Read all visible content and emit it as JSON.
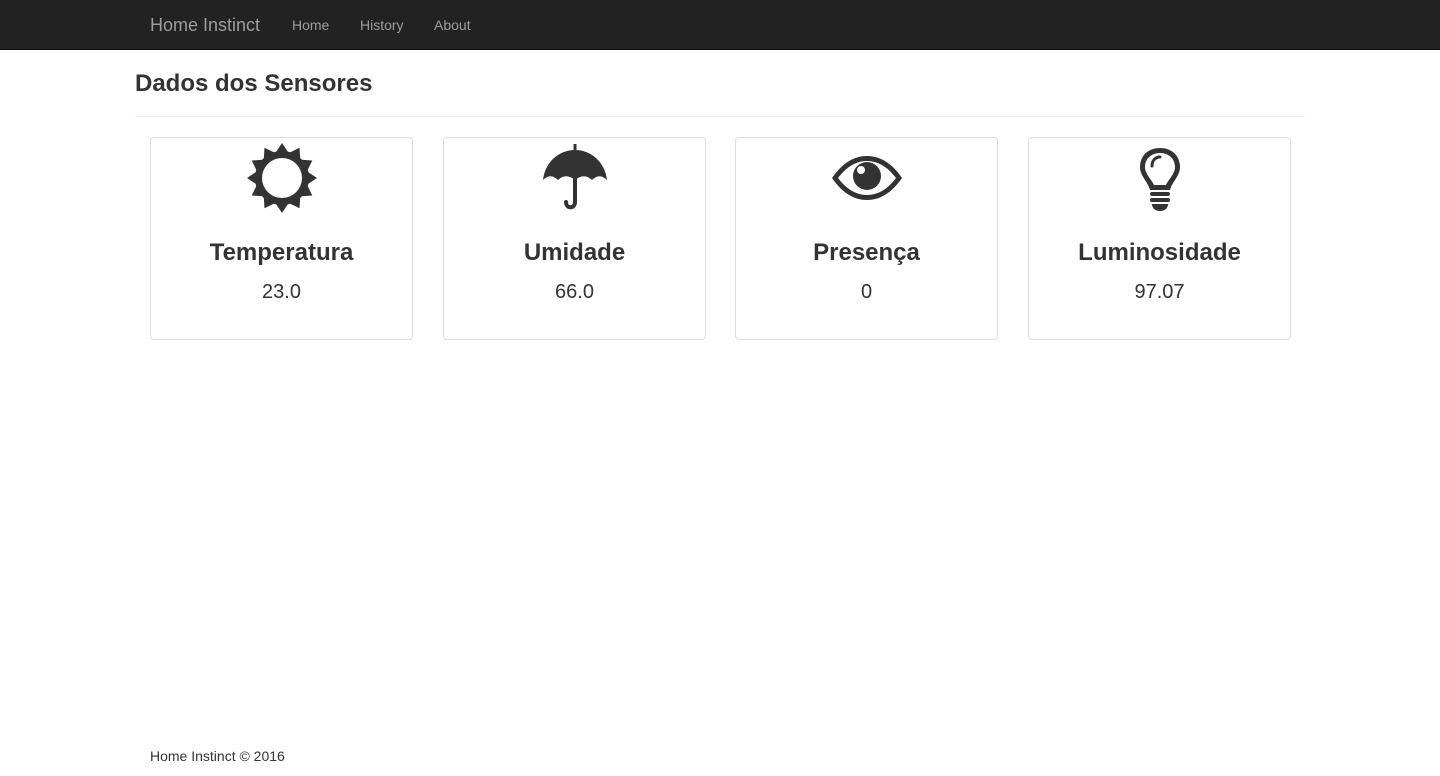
{
  "navbar": {
    "brand": "Home Instinct",
    "links": [
      "Home",
      "History",
      "About"
    ]
  },
  "page": {
    "title": "Dados dos Sensores"
  },
  "sensors": [
    {
      "icon": "sun-icon",
      "label": "Temperatura",
      "value": "23.0"
    },
    {
      "icon": "umbrella-icon",
      "label": "Umidade",
      "value": "66.0"
    },
    {
      "icon": "eye-icon",
      "label": "Presença",
      "value": "0"
    },
    {
      "icon": "lightbulb-icon",
      "label": "Luminosidade",
      "value": "97.07"
    }
  ],
  "footer": {
    "text": "Home Instinct © 2016"
  },
  "colors": {
    "navbar_bg": "#222222",
    "navbar_text": "#9d9d9d",
    "text": "#333333",
    "border": "#dddddd"
  }
}
